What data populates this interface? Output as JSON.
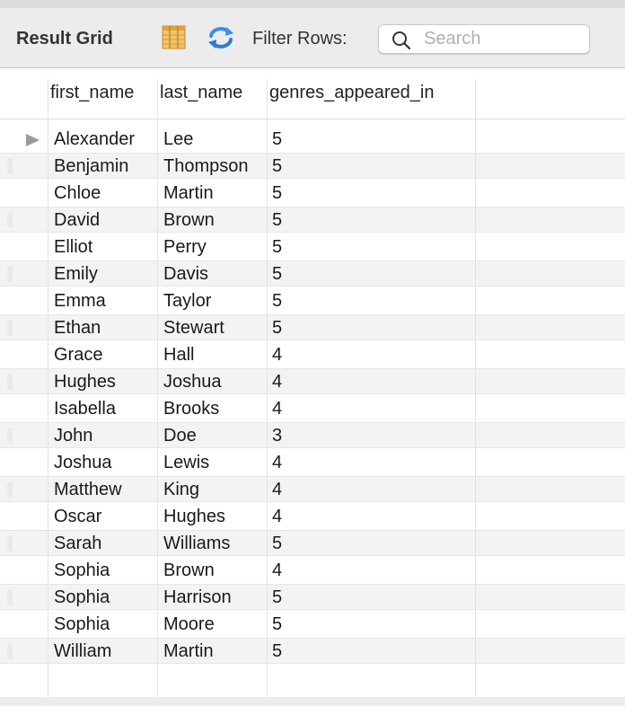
{
  "toolbar": {
    "title": "Result Grid",
    "filter_label": "Filter Rows:",
    "search_placeholder": "Search",
    "icons": [
      "grid-columns-icon",
      "refresh-icon",
      "search-icon"
    ]
  },
  "grid": {
    "columns": [
      "first_name",
      "last_name",
      "genres_appeared_in"
    ],
    "rows": [
      [
        "Alexander",
        "Lee",
        "5"
      ],
      [
        "Benjamin",
        "Thompson",
        "5"
      ],
      [
        "Chloe",
        "Martin",
        "5"
      ],
      [
        "David",
        "Brown",
        "5"
      ],
      [
        "Elliot",
        "Perry",
        "5"
      ],
      [
        "Emily",
        "Davis",
        "5"
      ],
      [
        "Emma",
        "Taylor",
        "5"
      ],
      [
        "Ethan",
        "Stewart",
        "5"
      ],
      [
        "Grace",
        "Hall",
        "4"
      ],
      [
        "Hughes",
        "Joshua",
        "4"
      ],
      [
        "Isabella",
        "Brooks",
        "4"
      ],
      [
        "John",
        "Doe",
        "3"
      ],
      [
        "Joshua",
        "Lewis",
        "4"
      ],
      [
        "Matthew",
        "King",
        "4"
      ],
      [
        "Oscar",
        "Hughes",
        "4"
      ],
      [
        "Sarah",
        "Williams",
        "5"
      ],
      [
        "Sophia",
        "Brown",
        "4"
      ],
      [
        "Sophia",
        "Harrison",
        "5"
      ],
      [
        "Sophia",
        "Moore",
        "5"
      ],
      [
        "William",
        "Martin",
        "5"
      ]
    ]
  },
  "colors": {
    "toolbar_bg": "#ececec",
    "row_stripe": "#f3f3f3",
    "refresh_icon": "#3a8ee6",
    "grid_icon": "#e8a93a"
  }
}
